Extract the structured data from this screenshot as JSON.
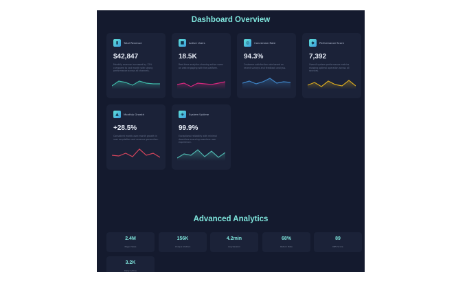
{
  "dashboard": {
    "title": "Dashboard Overview"
  },
  "cards": [
    {
      "label": "Total Revenue",
      "value": "$42,847",
      "desc": "Monthly revenue increased by 12% compared to last month with strong performance across all channels.",
      "color": "#3fb8a8",
      "icon": "chart-icon"
    },
    {
      "label": "Active Users",
      "value": "18.5K",
      "desc": "Real-time analytics showing active users on web engaging with the platform.",
      "color": "#d6287e",
      "icon": "users-icon"
    },
    {
      "label": "Conversion Rate",
      "value": "94.3%",
      "desc": "Customer satisfaction rate based on recent surveys and feedback analysis.",
      "color": "#3f86c9",
      "icon": "target-icon"
    },
    {
      "label": "Performance Score",
      "value": "7,392",
      "desc": "Overall system performance metrics showing optimal operation across all services.",
      "color": "#d6a820",
      "icon": "bolt-icon"
    },
    {
      "label": "Monthly Growth",
      "value": "+28.5%",
      "desc": "Consistent month-over-month growth in user acquisition and revenue generation.",
      "color": "#d6455c",
      "icon": "growth-icon"
    },
    {
      "label": "System Uptime",
      "value": "99.9%",
      "desc": "Exceptional reliability with minimal downtime ensuring seamless user experience.",
      "color": "#4fb8b0",
      "icon": "shield-icon"
    }
  ],
  "analytics": {
    "title": "Advanced Analytics",
    "stats": [
      {
        "value": "2.4M",
        "label": "Page Views"
      },
      {
        "value": "156K",
        "label": "Unique Visitors"
      },
      {
        "value": "4.2min",
        "label": "Avg Session"
      },
      {
        "value": "68%",
        "label": "Return Rate"
      },
      {
        "value": "89",
        "label": "NPS Score"
      },
      {
        "value": "3.2K",
        "label": "Daily Active"
      }
    ]
  }
}
